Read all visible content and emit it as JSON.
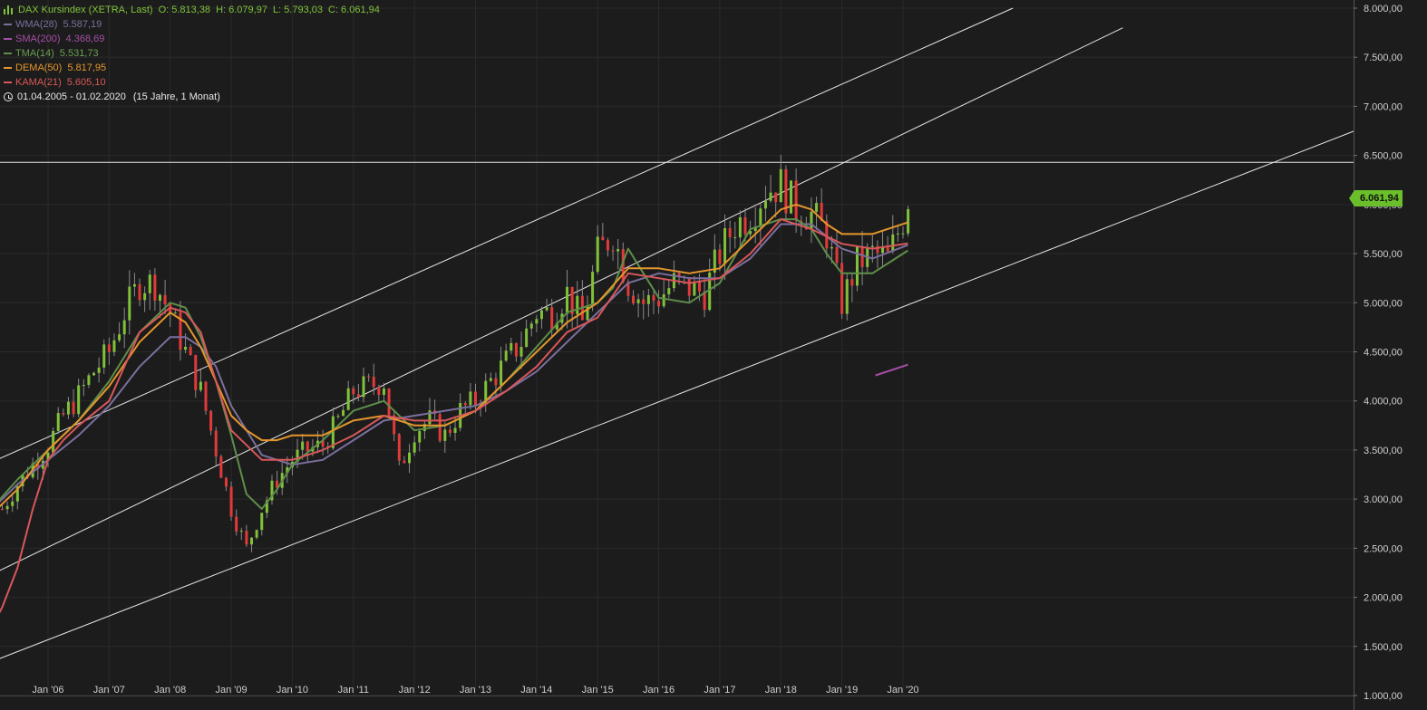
{
  "legend": {
    "instrument": "DAX Kursindex (XETRA, Last)",
    "ohlc": {
      "open": "O: 5.813,38",
      "high": "H: 6.079,97",
      "low": "L: 5.793,03",
      "close": "C: 6.061,94"
    },
    "indicators": [
      {
        "name": "WMA(28)",
        "value": "5.587,19",
        "color": "#7b6f9e"
      },
      {
        "name": "SMA(200)",
        "value": "4.368,69",
        "color": "#a54fa6"
      },
      {
        "name": "TMA(14)",
        "value": "5.531,73",
        "color": "#5e8f4a"
      },
      {
        "name": "DEMA(50)",
        "value": "5.817,95",
        "color": "#e5962c"
      },
      {
        "name": "KAMA(21)",
        "value": "5.605,10",
        "color": "#d9575a"
      }
    ],
    "range": "01.04.2005 - 01.02.2020",
    "range_span": "(15 Jahre, 1 Monat)"
  },
  "last_price_label": "6.061,94",
  "colors": {
    "background": "#1c1c1c",
    "up": "#7fc23a",
    "down": "#e23a3a",
    "text": "#cfcfcf",
    "grid": "#2a2a2a",
    "trendline": "#ffffff"
  },
  "chart_data": {
    "type": "line",
    "title": "DAX Kursindex (XETRA, Last)",
    "ylim": [
      1000,
      8000
    ],
    "grid": true,
    "y_ticks": [
      {
        "value": 8000,
        "label": "8.000,00"
      },
      {
        "value": 7500,
        "label": "7.500,00"
      },
      {
        "value": 7000,
        "label": "7.000,00"
      },
      {
        "value": 6500,
        "label": "6.500,00"
      },
      {
        "value": 6000,
        "label": "6.000,00"
      },
      {
        "value": 5500,
        "label": "5.500,00"
      },
      {
        "value": 5000,
        "label": "5.000,00"
      },
      {
        "value": 4500,
        "label": "4.500,00"
      },
      {
        "value": 4000,
        "label": "4.000,00"
      },
      {
        "value": 3500,
        "label": "3.500,00"
      },
      {
        "value": 3000,
        "label": "3.000,00"
      },
      {
        "value": 2500,
        "label": "2.500,00"
      },
      {
        "value": 2000,
        "label": "2.000,00"
      },
      {
        "value": 1500,
        "label": "1.500,00"
      },
      {
        "value": 1000,
        "label": "1.000,00"
      }
    ],
    "x_ticks": [
      {
        "value": 2006,
        "label": "Jan '06"
      },
      {
        "value": 2007,
        "label": "Jan '07"
      },
      {
        "value": 2008,
        "label": "Jan '08"
      },
      {
        "value": 2009,
        "label": "Jan '09"
      },
      {
        "value": 2010,
        "label": "Jan '10"
      },
      {
        "value": 2011,
        "label": "Jan '11"
      },
      {
        "value": 2012,
        "label": "Jan '12"
      },
      {
        "value": 2013,
        "label": "Jan '13"
      },
      {
        "value": 2014,
        "label": "Jan '14"
      },
      {
        "value": 2015,
        "label": "Jan '15"
      },
      {
        "value": 2016,
        "label": "Jan '16"
      },
      {
        "value": 2017,
        "label": "Jan '17"
      },
      {
        "value": 2018,
        "label": "Jan '18"
      },
      {
        "value": 2019,
        "label": "Jan '19"
      },
      {
        "value": 2020,
        "label": "Jan '20"
      }
    ],
    "price": {
      "x": [
        2005.25,
        2005.5,
        2005.75,
        2006.0,
        2006.25,
        2006.5,
        2006.75,
        2007.0,
        2007.25,
        2007.5,
        2007.75,
        2008.0,
        2008.25,
        2008.5,
        2008.75,
        2009.0,
        2009.25,
        2009.5,
        2009.75,
        2010.0,
        2010.25,
        2010.5,
        2010.75,
        2011.0,
        2011.25,
        2011.5,
        2011.75,
        2012.0,
        2012.25,
        2012.5,
        2012.75,
        2013.0,
        2013.25,
        2013.5,
        2013.75,
        2014.0,
        2014.25,
        2014.5,
        2014.75,
        2015.0,
        2015.25,
        2015.5,
        2015.75,
        2016.0,
        2016.25,
        2016.5,
        2016.75,
        2017.0,
        2017.25,
        2017.5,
        2017.75,
        2018.0,
        2018.25,
        2018.5,
        2018.75,
        2019.0,
        2019.25,
        2019.5,
        2019.75,
        2020.0,
        2020.08
      ],
      "values": [
        2900,
        3150,
        3350,
        3550,
        3850,
        4050,
        4300,
        4500,
        4900,
        5200,
        5200,
        4900,
        4500,
        4100,
        3500,
        2900,
        2500,
        2900,
        3200,
        3400,
        3500,
        3550,
        3800,
        4100,
        4150,
        4200,
        3300,
        3700,
        3800,
        3650,
        3900,
        4000,
        4200,
        4400,
        4600,
        4900,
        4900,
        5100,
        4800,
        5500,
        5700,
        5200,
        5000,
        5050,
        5200,
        5150,
        5100,
        5500,
        5800,
        5900,
        6150,
        6200,
        5950,
        5900,
        5700,
        5000,
        5400,
        5500,
        5450,
        5850,
        6061.94
      ]
    },
    "series": [
      {
        "name": "WMA(28)",
        "color": "#7b6f9e",
        "x": [
          2005.0,
          2005.5,
          2006.0,
          2006.5,
          2007.0,
          2007.5,
          2008.0,
          2008.25,
          2008.5,
          2008.75,
          2009.0,
          2009.5,
          2010.0,
          2010.5,
          2011.0,
          2011.5,
          2012.0,
          2012.5,
          2013.0,
          2013.5,
          2014.0,
          2014.5,
          2015.0,
          2015.5,
          2016.0,
          2016.5,
          2017.0,
          2017.5,
          2018.0,
          2018.5,
          2019.0,
          2019.5,
          2020.08
        ],
        "values": [
          2850,
          3150,
          3400,
          3650,
          3950,
          4350,
          4650,
          4650,
          4550,
          4350,
          3950,
          3450,
          3350,
          3400,
          3600,
          3800,
          3850,
          3900,
          3950,
          4100,
          4300,
          4600,
          4900,
          5200,
          5300,
          5250,
          5250,
          5450,
          5800,
          5800,
          5550,
          5450,
          5587.19
        ]
      },
      {
        "name": "SMA(200)",
        "color": "#a54fa6",
        "x": [
          2019.55,
          2020.08
        ],
        "values": [
          4260,
          4368.69
        ]
      },
      {
        "name": "TMA(14)",
        "color": "#5e8f4a",
        "x": [
          2005.0,
          2005.5,
          2006.0,
          2006.5,
          2007.0,
          2007.5,
          2008.0,
          2008.25,
          2008.5,
          2008.75,
          2009.0,
          2009.25,
          2009.5,
          2009.75,
          2010.0,
          2010.5,
          2011.0,
          2011.5,
          2012.0,
          2012.5,
          2013.0,
          2013.5,
          2014.0,
          2014.5,
          2015.0,
          2015.25,
          2015.5,
          2015.75,
          2016.0,
          2016.5,
          2017.0,
          2017.5,
          2018.0,
          2018.25,
          2018.5,
          2018.75,
          2019.0,
          2019.5,
          2020.08
        ],
        "values": [
          2850,
          3200,
          3500,
          3800,
          4200,
          4700,
          5000,
          4950,
          4650,
          4200,
          3650,
          3050,
          2900,
          3100,
          3350,
          3600,
          3900,
          4000,
          3700,
          3750,
          3900,
          4200,
          4550,
          4900,
          5000,
          5150,
          5550,
          5300,
          5050,
          5000,
          5200,
          5750,
          5850,
          5850,
          5750,
          5500,
          5300,
          5300,
          5531.73
        ]
      },
      {
        "name": "DEMA(50)",
        "color": "#e5962c",
        "x": [
          2005.0,
          2005.5,
          2006.0,
          2006.5,
          2007.0,
          2007.5,
          2008.0,
          2008.25,
          2008.5,
          2008.75,
          2009.0,
          2009.25,
          2009.5,
          2009.75,
          2010.0,
          2010.5,
          2011.0,
          2011.5,
          2012.0,
          2012.5,
          2013.0,
          2013.5,
          2014.0,
          2014.5,
          2015.0,
          2015.5,
          2016.0,
          2016.5,
          2017.0,
          2017.5,
          2018.0,
          2018.25,
          2018.5,
          2018.75,
          2019.0,
          2019.5,
          2020.08
        ],
        "values": [
          2800,
          3100,
          3500,
          3800,
          4150,
          4600,
          4900,
          4800,
          4550,
          4200,
          3850,
          3700,
          3600,
          3600,
          3650,
          3650,
          3800,
          3850,
          3750,
          3750,
          3900,
          4200,
          4500,
          4800,
          5000,
          5350,
          5350,
          5300,
          5350,
          5650,
          5950,
          6000,
          5950,
          5800,
          5700,
          5700,
          5817.95
        ]
      },
      {
        "name": "KAMA(21)",
        "color": "#d9575a",
        "x": [
          2005.0,
          2005.25,
          2005.5,
          2005.75,
          2006.0,
          2006.25,
          2006.5,
          2007.0,
          2007.5,
          2008.0,
          2008.25,
          2008.5,
          2008.75,
          2009.0,
          2009.5,
          2010.0,
          2010.5,
          2011.0,
          2011.5,
          2012.0,
          2012.5,
          2013.0,
          2013.5,
          2014.0,
          2014.5,
          2015.0,
          2015.5,
          2016.0,
          2016.5,
          2017.0,
          2017.5,
          2018.0,
          2018.5,
          2019.0,
          2019.5,
          2020.08
        ],
        "values": [
          1600,
          1900,
          2300,
          2900,
          3400,
          3600,
          3750,
          4000,
          4700,
          4950,
          4900,
          4700,
          4200,
          3700,
          3400,
          3400,
          3500,
          3650,
          3850,
          3800,
          3800,
          3900,
          4100,
          4350,
          4700,
          4850,
          5300,
          5250,
          5200,
          5250,
          5500,
          5850,
          5750,
          5600,
          5550,
          5605.1
        ]
      }
    ],
    "trendlines": [
      {
        "x": [
          2004.8,
          2021.8
        ],
        "values": [
          3300,
          8000
        ]
      },
      {
        "x": [
          2004.8,
          2023.6
        ],
        "values": [
          2150,
          7800
        ]
      },
      {
        "x": [
          2005.1,
          2027.6
        ],
        "values": [
          1350,
          6800
        ]
      }
    ],
    "horizontal_lines": [
      6430
    ]
  }
}
